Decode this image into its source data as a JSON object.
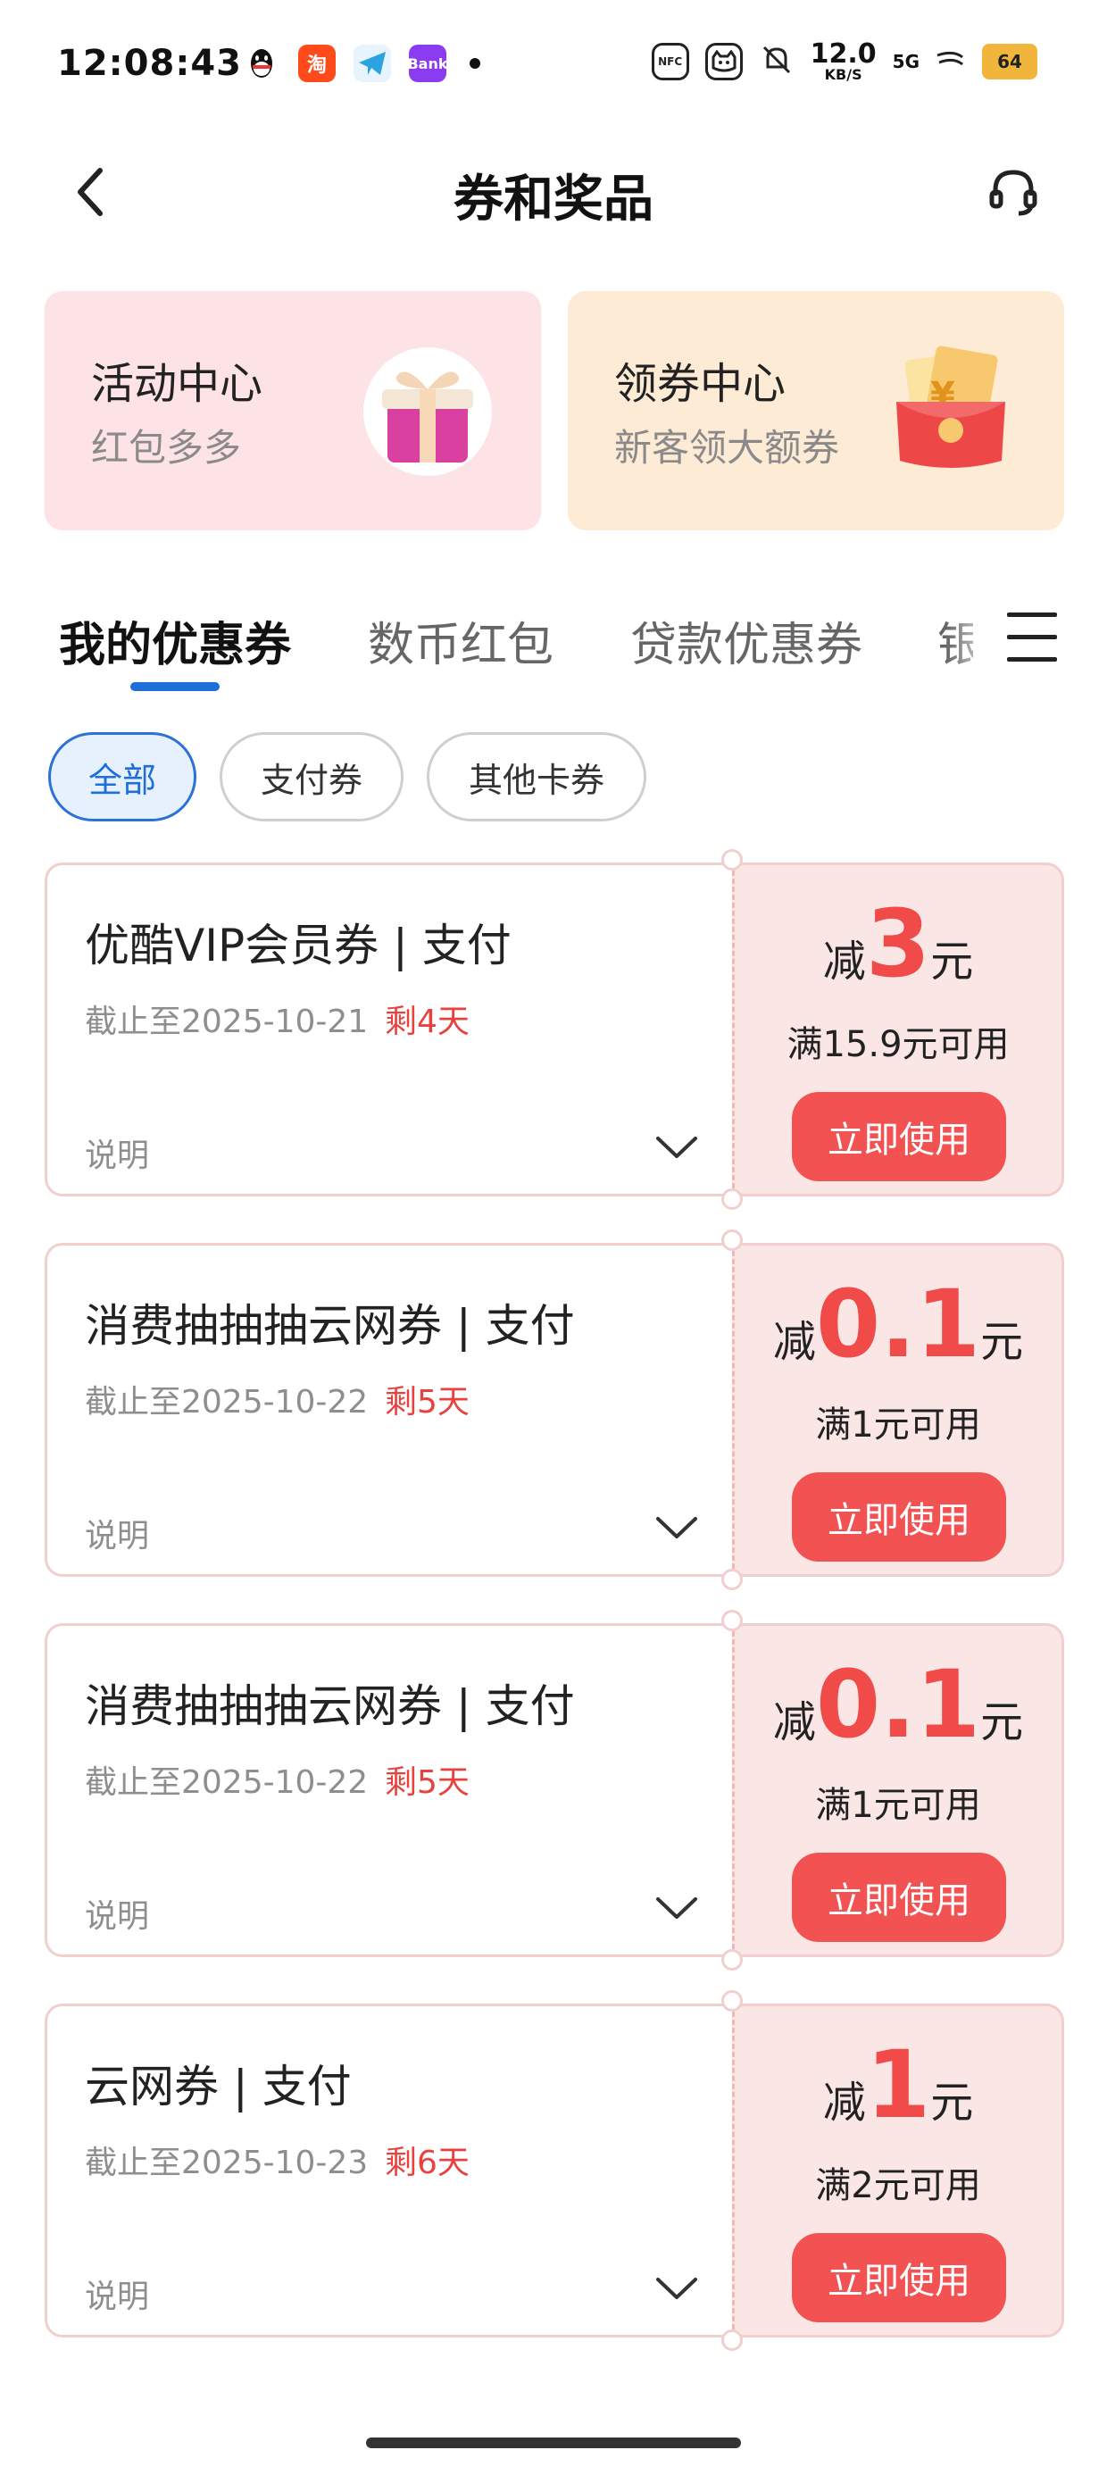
{
  "status_bar": {
    "time": "12:08:43",
    "net_speed": "12.0",
    "net_unit": "KB/S",
    "signal": "5G",
    "battery": "64",
    "nfc": "NFC"
  },
  "header": {
    "title": "券和奖品"
  },
  "promos": [
    {
      "title": "活动中心",
      "subtitle": "红包多多",
      "icon": "gift-box-icon"
    },
    {
      "title": "领券中心",
      "subtitle": "新客领大额券",
      "icon": "red-envelope-icon"
    }
  ],
  "tabs": [
    {
      "label": "我的优惠券",
      "active": true
    },
    {
      "label": "数币红包",
      "active": false
    },
    {
      "label": "贷款优惠券",
      "active": false
    },
    {
      "label": "银",
      "active": false
    }
  ],
  "filters": [
    {
      "label": "全部",
      "active": true
    },
    {
      "label": "支付券",
      "active": false
    },
    {
      "label": "其他卡券",
      "active": false
    }
  ],
  "coupons": [
    {
      "title": "优酷VIP会员券 | 支付",
      "deadline": "截止至2025-10-21",
      "remain": "剩4天",
      "note": "说明",
      "prefix": "减",
      "amount": "3",
      "unit": "元",
      "condition": "满15.9元可用",
      "button": "立即使用"
    },
    {
      "title": "消费抽抽抽云网券 | 支付",
      "deadline": "截止至2025-10-22",
      "remain": "剩5天",
      "note": "说明",
      "prefix": "减",
      "amount": "0.1",
      "unit": "元",
      "condition": "满1元可用",
      "button": "立即使用"
    },
    {
      "title": "消费抽抽抽云网券 | 支付",
      "deadline": "截止至2025-10-22",
      "remain": "剩5天",
      "note": "说明",
      "prefix": "减",
      "amount": "0.1",
      "unit": "元",
      "condition": "满1元可用",
      "button": "立即使用"
    },
    {
      "title": "云网券 | 支付",
      "deadline": "截止至2025-10-23",
      "remain": "剩6天",
      "note": "说明",
      "prefix": "减",
      "amount": "1",
      "unit": "元",
      "condition": "满2元可用",
      "button": "立即使用"
    }
  ],
  "colors": {
    "accent_blue": "#1f6fd8",
    "coupon_red": "#f04a49",
    "button_red": "#f35252"
  }
}
